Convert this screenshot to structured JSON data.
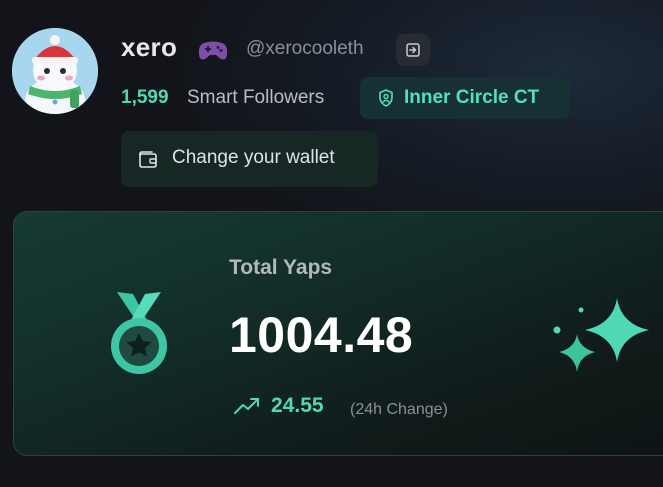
{
  "profile": {
    "name": "xero",
    "handle": "@xerocooleth",
    "followers_count": "1,599",
    "followers_label": "Smart Followers",
    "badge_label": "Inner Circle CT",
    "wallet_button_label": "Change your wallet"
  },
  "yaps_card": {
    "title": "Total Yaps",
    "value": "1004.48",
    "change_value": "24.55",
    "change_label": "(24h Change)"
  },
  "icons": {
    "avatar": "snowman-avatar",
    "name_emoji": "gamepad-icon",
    "login": "login-icon",
    "badge": "shield-user-icon",
    "wallet": "wallet-icon",
    "medal": "medal-star-icon",
    "trend": "trending-up-icon",
    "sparkles": "sparkles-icon"
  },
  "colors": {
    "accent": "#4fd8b4",
    "background": "#131418",
    "card_background": "#153430",
    "badge_background": "#163034",
    "gamepad": "#7b4ea8"
  }
}
